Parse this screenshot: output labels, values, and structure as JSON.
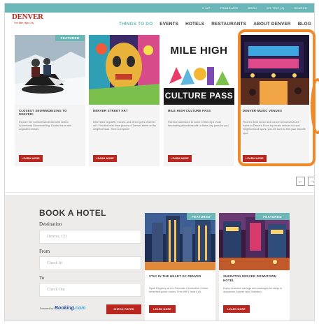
{
  "topbar": {
    "items": [
      "☀ 68°",
      "TRANSLATE",
      "BOOK",
      "MY TRIP (0)",
      "SEARCH"
    ]
  },
  "logo": {
    "name": "DENVER",
    "tagline": "The Mile High City"
  },
  "nav": {
    "items": [
      {
        "label": "THINGS TO DO",
        "active": true
      },
      {
        "label": "EVENTS"
      },
      {
        "label": "HOTELS"
      },
      {
        "label": "RESTAURANTS"
      },
      {
        "label": "ABOUT DENVER"
      },
      {
        "label": "BLOG"
      }
    ]
  },
  "featured_label": "FEATURED",
  "cards": [
    {
      "title": "CLOSEST SNOWMOBILING TO DENVER!",
      "text": "Explore the Continental Divide with Grand Adventures Snowmobiling. Guided tours and unguided rentals.",
      "button": "LEARN MORE"
    },
    {
      "title": "DENVER STREET ART",
      "text": "Interested in graffiti, murals, and other types of street art? Find the best three places of Denver street art by neighborhood. Time to explore!",
      "button": "LEARN MORE"
    },
    {
      "title": "MILE HIGH CULTURE PASS",
      "text": "Receive admission to some of the city's most fascinating attractions with a three-day pass for you.",
      "button": "LEARN MORE",
      "poster": {
        "line1": "MILE HIGH",
        "line2": "CULTURE PASS"
      }
    },
    {
      "title": "DENVER MUSIC VENUES",
      "text": "Find the best music and concert venues that are home to Denver. From top music venues to local neighborhood spots, you are sure to find your favorite spot.",
      "button": "LEARN MORE"
    }
  ],
  "arrows": {
    "prev": "←",
    "next": "→"
  },
  "hotel": {
    "title": "BOOK A HOTEL",
    "destination_label": "Destination",
    "destination_placeholder": "Denver, CO",
    "from_label": "From",
    "from_placeholder": "Check In",
    "to_label": "To",
    "to_placeholder": "Check Out",
    "powered_by": "Powered by",
    "booking_brand": "Booking",
    "booking_suffix": ".com",
    "check_button": "CHECK RATES",
    "cards": [
      {
        "title": "STAY IN THE HEART OF DENVER",
        "text": "Hyatt Regency at the Colorado Convention Center refreshed guest rooms. Free WiFi, heat it all.",
        "button": "LEARN MORE"
      },
      {
        "title": "SHERATON DENVER DOWNTOWN HOTEL",
        "text": "Enjoy exclusive savings and packages for stays in downtown Denver with Sheraton.",
        "button": "LEARN MORE"
      }
    ]
  },
  "colors": {
    "teal": "#6bb7b8",
    "brand_red": "#b9261f",
    "highlight_orange": "#ef8a2b"
  }
}
